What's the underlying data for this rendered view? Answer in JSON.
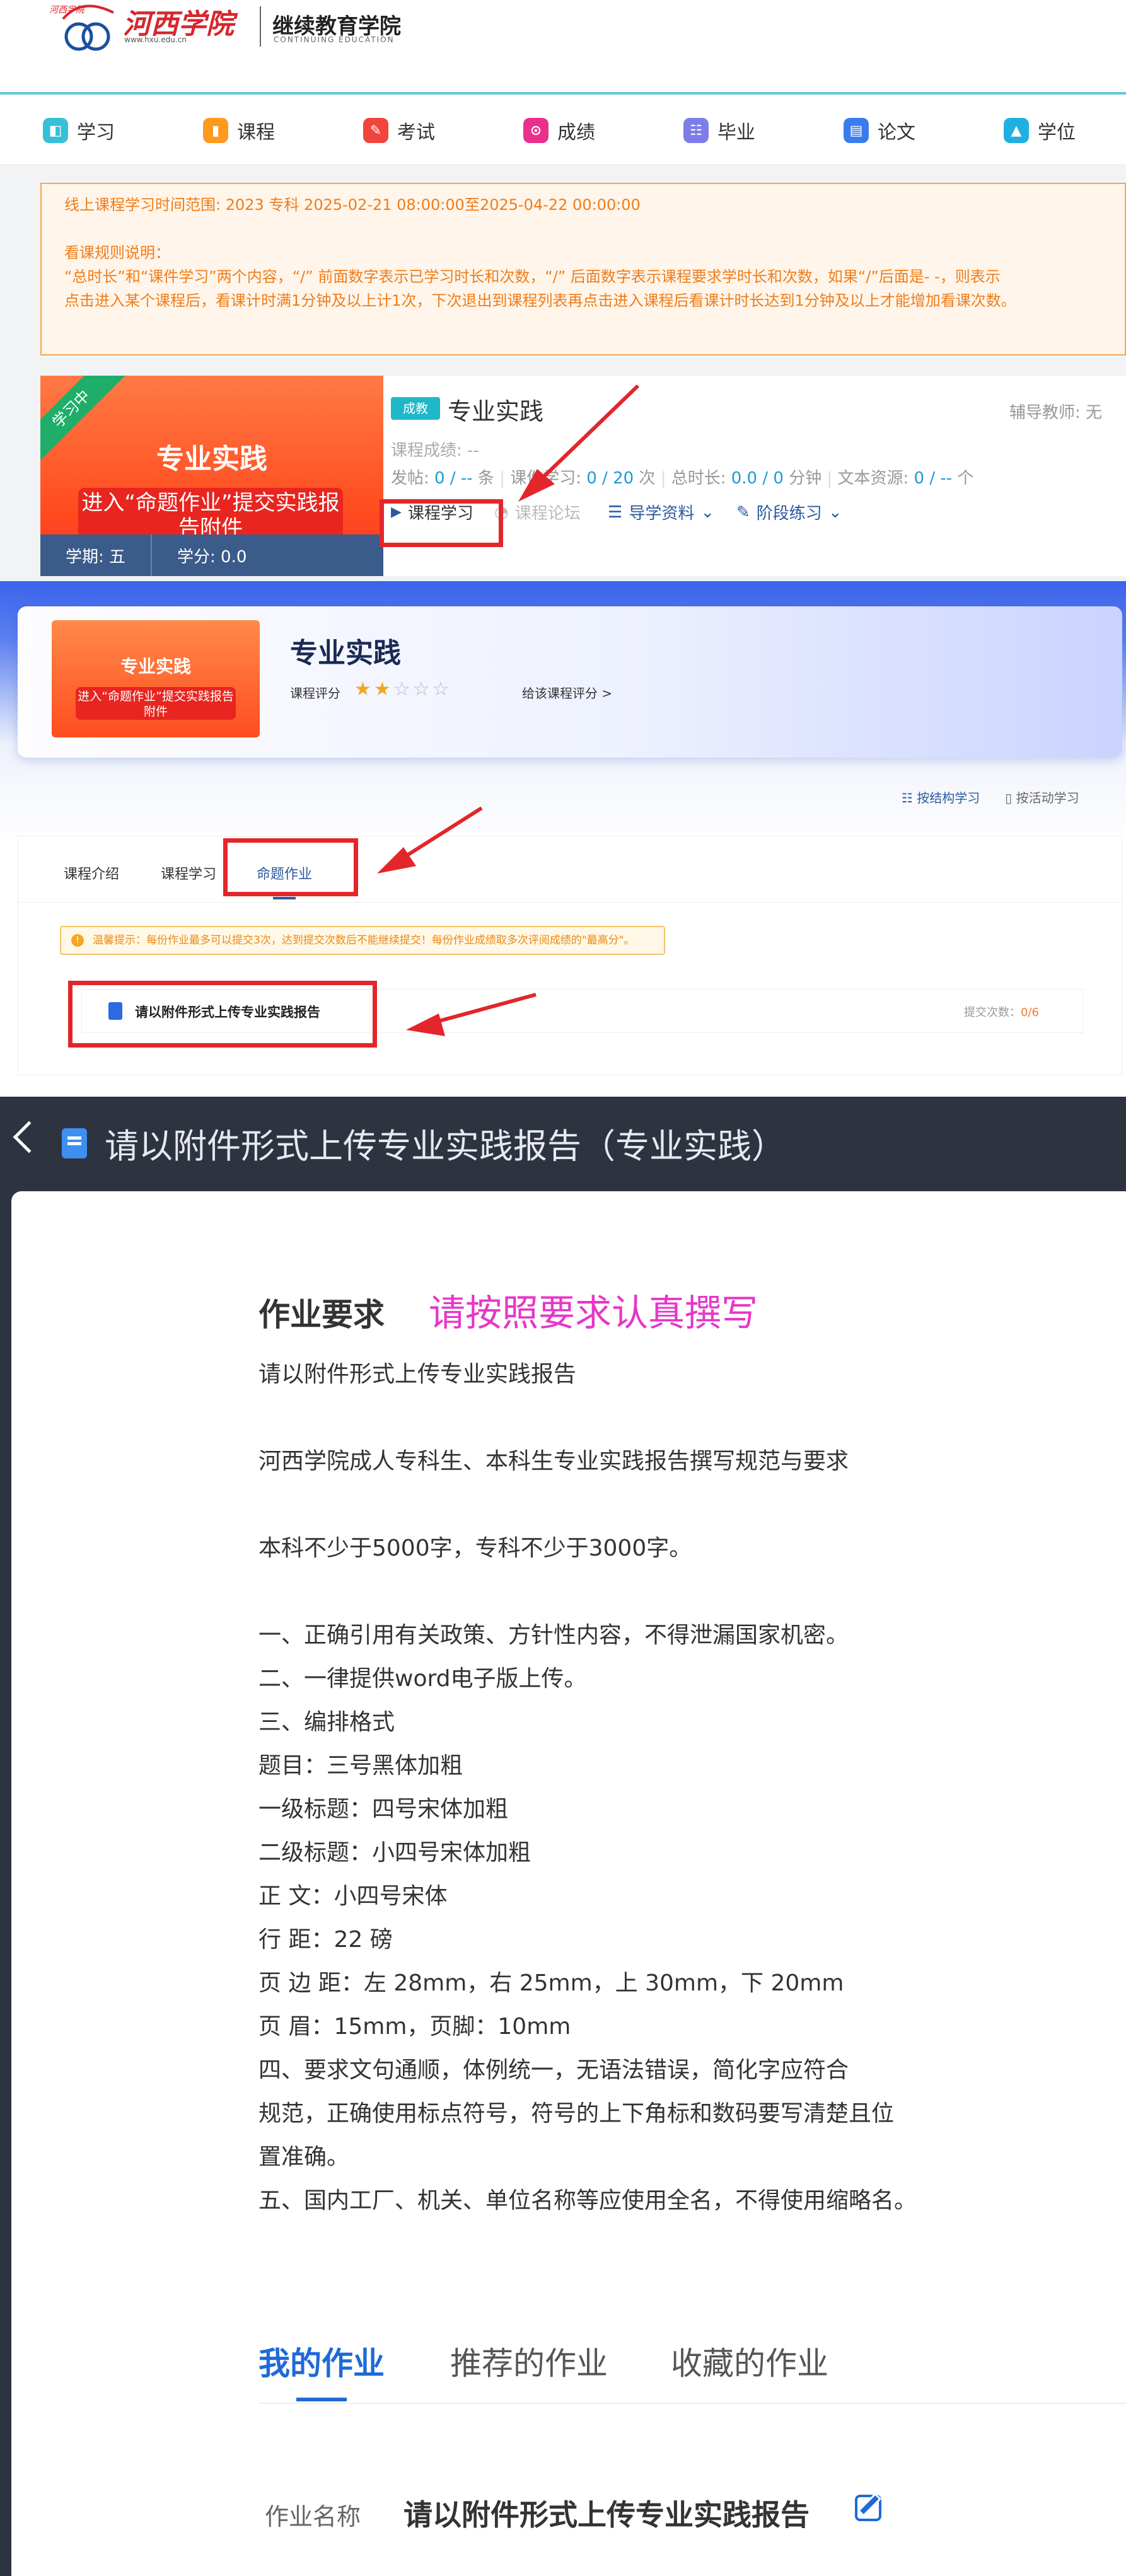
{
  "portal": {
    "logo": {
      "script_text": "河西学院",
      "url_text": "www.hxu.edu.cn",
      "name_cn": "继续教育学院",
      "name_en": "CONTINUING EDUCATION"
    },
    "nav": [
      {
        "label": "学习",
        "icon": "book-icon",
        "color": "#36c0d8"
      },
      {
        "label": "课程",
        "icon": "course-icon",
        "color": "#ff9a1f"
      },
      {
        "label": "考试",
        "icon": "exam-icon",
        "color": "#f0443c"
      },
      {
        "label": "成绩",
        "icon": "score-icon",
        "color": "#e8308c"
      },
      {
        "label": "毕业",
        "icon": "graduation-icon",
        "color": "#7f7de8"
      },
      {
        "label": "论文",
        "icon": "paper-icon",
        "color": "#3a7cf0"
      },
      {
        "label": "学位",
        "icon": "degree-icon",
        "color": "#20b0e0"
      }
    ],
    "notice": {
      "line1": "线上课程学习时间范围: 2023 专科 2025-02-21 08:00:00至2025-04-22 00:00:00",
      "line2": "看课规则说明：",
      "line3": "“总时长”和“课件学习”两个内容，“/” 前面数字表示已学习时长和次数，“/” 后面数字表示课程要求学时长和次数，如果“/”后面是- -，则表示",
      "line4": "点击进入某个课程后，看课计时满1分钟及以上计1次，下次退出到课程列表再点击进入课程后看课计时长达到1分钟及以上才能增加看课次数。"
    },
    "course": {
      "thumb_ribbon": "学习中",
      "thumb_title": "专业实践",
      "thumb_sub": "进入“命题作业”提交实践报告附件",
      "term": "学期: 五",
      "credit": "学分: 0.0",
      "tag": "成教",
      "name": "专业实践",
      "teacher": "辅导教师: 无",
      "grade": "课程成绩: --",
      "stats": {
        "post_label": "发帖: ",
        "post_value": "0 / -- ",
        "post_unit": "条",
        "courseware_label": "课件学习: ",
        "courseware_value": "0 / 20",
        "courseware_unit": " 次",
        "duration_label": "总时长: ",
        "duration_value": "0.0 / 0",
        "duration_unit": " 分钟",
        "text_label": "文本资源: ",
        "text_value": "0 / -- ",
        "text_unit": "个"
      },
      "actions": {
        "study": "课程学习",
        "forum": "课程论坛",
        "guide": "导学资料",
        "practice": "阶段练习"
      }
    }
  },
  "course_page": {
    "thumb_title": "专业实践",
    "thumb_sub": "进入“命题作业”提交实践报告附件",
    "title": "专业实践",
    "rating_label": "课程评分",
    "rating": 2,
    "rating_max": 5,
    "give_rating": "给该课程评分 >",
    "view_modes": {
      "structure": "按结构学习",
      "activity": "按活动学习"
    },
    "tabs": [
      "课程介绍",
      "课程学习",
      "命题作业"
    ],
    "tip": "温馨提示：每份作业最多可以提交3次，达到提交次数后不能继续提交！每份作业成绩取多次评阅成绩的\"最高分\"。",
    "tip_icon": "!",
    "homework": {
      "name": "请以附件形式上传专业实践报告",
      "submit_label": "提交次数：",
      "submit_value": "0/6"
    }
  },
  "assignment": {
    "title": "请以附件形式上传专业实践报告（专业实践）",
    "req_heading": "作业要求",
    "req_note": "请按照要求认真撰写",
    "body": [
      "请以附件形式上传专业实践报告",
      "",
      "河西学院成人专科生、本科生专业实践报告撰写规范与要求",
      "",
      "本科不少于5000字，专科不少于3000字。",
      "",
      "一、正确引用有关政策、方针性内容，不得泄漏国家机密。",
      "二、一律提供word电子版上传。",
      "三、编排格式",
      "题目：三号黑体加粗",
      "一级标题：四号宋体加粗",
      "二级标题：小四号宋体加粗",
      "正 文：小四号宋体",
      "行 距：22 磅",
      "页 边 距：左 28mm，右 25mm，上 30mm，下 20mm",
      "页 眉：15mm，页脚：10mm",
      "四、要求文句通顺，体例统一，无语法错误，简化字应符合",
      "规范，正确使用标点符号，符号的上下角标和数码要写清楚且位",
      "置准确。",
      "五、国内工厂、机关、单位名称等应使用全名，不得使用缩略名。"
    ],
    "tabs": [
      "我的作业",
      "推荐的作业",
      "收藏的作业"
    ],
    "field_label": "作业名称",
    "field_value": "请以附件形式上传专业实践报告"
  },
  "colors": {
    "accent": "#1e6ad8",
    "annotation": "#e3262c",
    "notice": "#ef7d1a"
  }
}
